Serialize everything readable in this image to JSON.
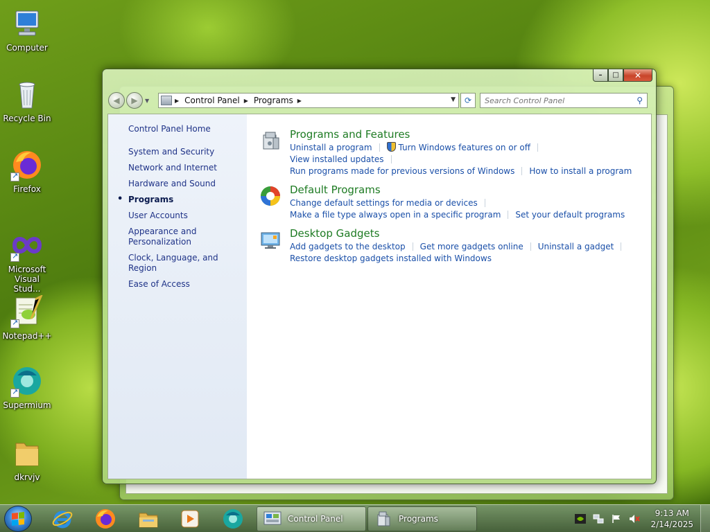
{
  "desktop": {
    "icons": [
      {
        "label": "Computer",
        "icon": "computer-icon"
      },
      {
        "label": "Recycle Bin",
        "icon": "recycle-bin-icon"
      },
      {
        "label": "Firefox",
        "icon": "firefox-icon"
      },
      {
        "label": "Microsoft Visual Stud...",
        "icon": "visual-studio-icon"
      },
      {
        "label": "Notepad++",
        "icon": "notepadpp-icon"
      },
      {
        "label": "Supermium",
        "icon": "supermium-icon"
      },
      {
        "label": "dkrvjv",
        "icon": "folder-icon"
      }
    ]
  },
  "window": {
    "title": "Programs",
    "controls": {
      "minimize": "–",
      "maximize": "□",
      "close": "✕"
    },
    "breadcrumb": [
      "Control Panel",
      "Programs"
    ],
    "search_placeholder": "Search Control Panel",
    "sidebar": {
      "items": [
        {
          "label": "Control Panel Home"
        },
        {
          "label": "System and Security"
        },
        {
          "label": "Network and Internet"
        },
        {
          "label": "Hardware and Sound"
        },
        {
          "label": "Programs",
          "active": true
        },
        {
          "label": "User Accounts"
        },
        {
          "label": "Appearance and Personalization"
        },
        {
          "label": "Clock, Language, and Region"
        },
        {
          "label": "Ease of Access"
        }
      ]
    },
    "sections": [
      {
        "title": "Programs and Features",
        "links": [
          "Uninstall a program",
          "Turn Windows features on or off",
          "View installed updates",
          "Run programs made for previous versions of Windows",
          "How to install a program"
        ]
      },
      {
        "title": "Default Programs",
        "links": [
          "Change default settings for media or devices",
          "Make a file type always open in a specific program",
          "Set your default programs"
        ]
      },
      {
        "title": "Desktop Gadgets",
        "links": [
          "Add gadgets to the desktop",
          "Get more gadgets online",
          "Uninstall a gadget",
          "Restore desktop gadgets installed with Windows"
        ]
      }
    ]
  },
  "taskbar": {
    "pinned": [
      "internet-explorer-icon",
      "firefox-icon",
      "file-explorer-icon",
      "media-player-icon",
      "supermium-icon"
    ],
    "tasks": [
      {
        "label": "Control Panel"
      },
      {
        "label": "Programs"
      }
    ],
    "clock": {
      "time": "9:13 AM",
      "date": "2/14/2025"
    }
  },
  "colors": {
    "section_title": "#1e7b23",
    "link": "#1a4fa8",
    "sidebar_link": "#1e3287"
  }
}
